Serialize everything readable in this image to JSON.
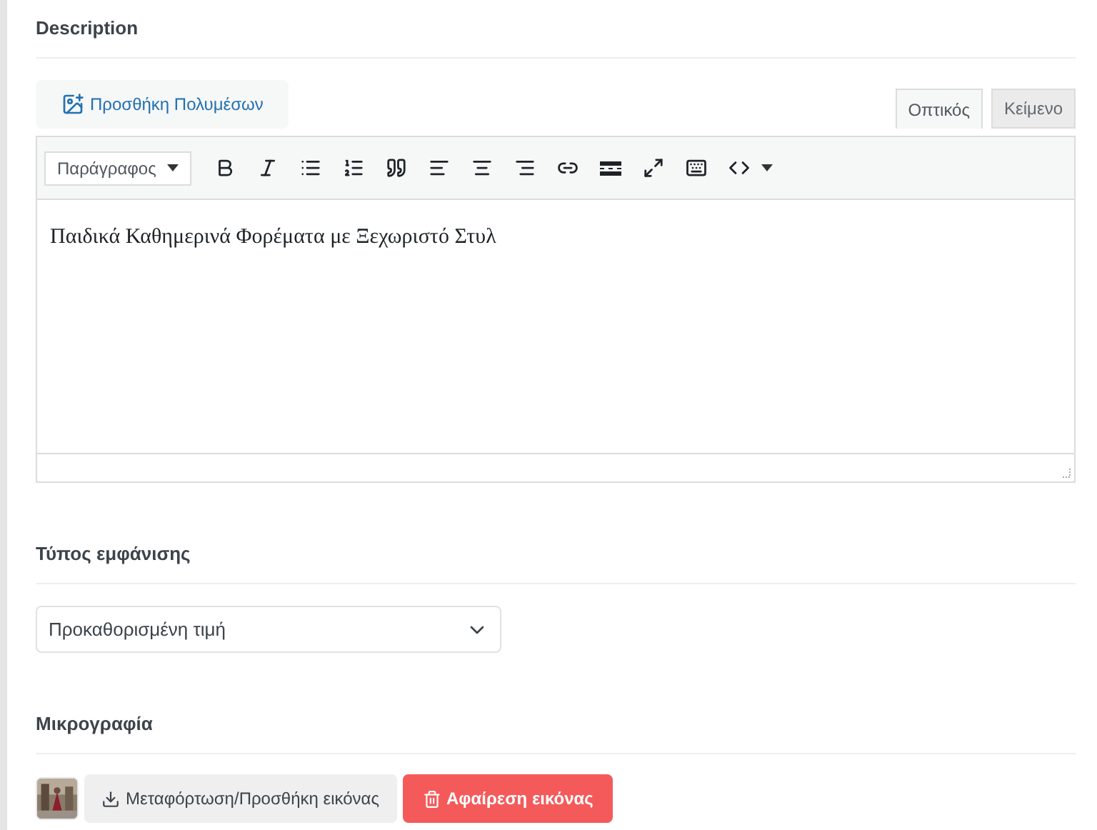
{
  "description": {
    "heading": "Description",
    "media_button": "Προσθήκη Πολυμέσων",
    "tabs": [
      {
        "label": "Οπτικός",
        "selected": true
      },
      {
        "label": "Κείμενο",
        "selected": false
      }
    ],
    "format_select": "Παράγραφος",
    "toolbar": [
      {
        "kind": "bold"
      },
      {
        "kind": "italic"
      },
      {
        "kind": "bullet-list"
      },
      {
        "kind": "numbered-list"
      },
      {
        "kind": "quote"
      },
      {
        "kind": "align-left"
      },
      {
        "kind": "align-center"
      },
      {
        "kind": "align-right"
      },
      {
        "kind": "link"
      },
      {
        "kind": "read-more"
      },
      {
        "kind": "fullscreen"
      },
      {
        "kind": "keyboard"
      },
      {
        "kind": "code"
      }
    ],
    "content": "Παιδικά Καθημερινά Φορέματα με Ξεχωριστό Στυλ"
  },
  "display_type": {
    "heading": "Τύπος εμφάνισης",
    "value": "Προκαθορισμένη τιμή"
  },
  "thumbnail": {
    "heading": "Μικρογραφία",
    "upload_button": "Μεταφόρτωση/Προσθήκη εικόνας",
    "remove_button": "Αφαίρεση εικόνας"
  }
}
